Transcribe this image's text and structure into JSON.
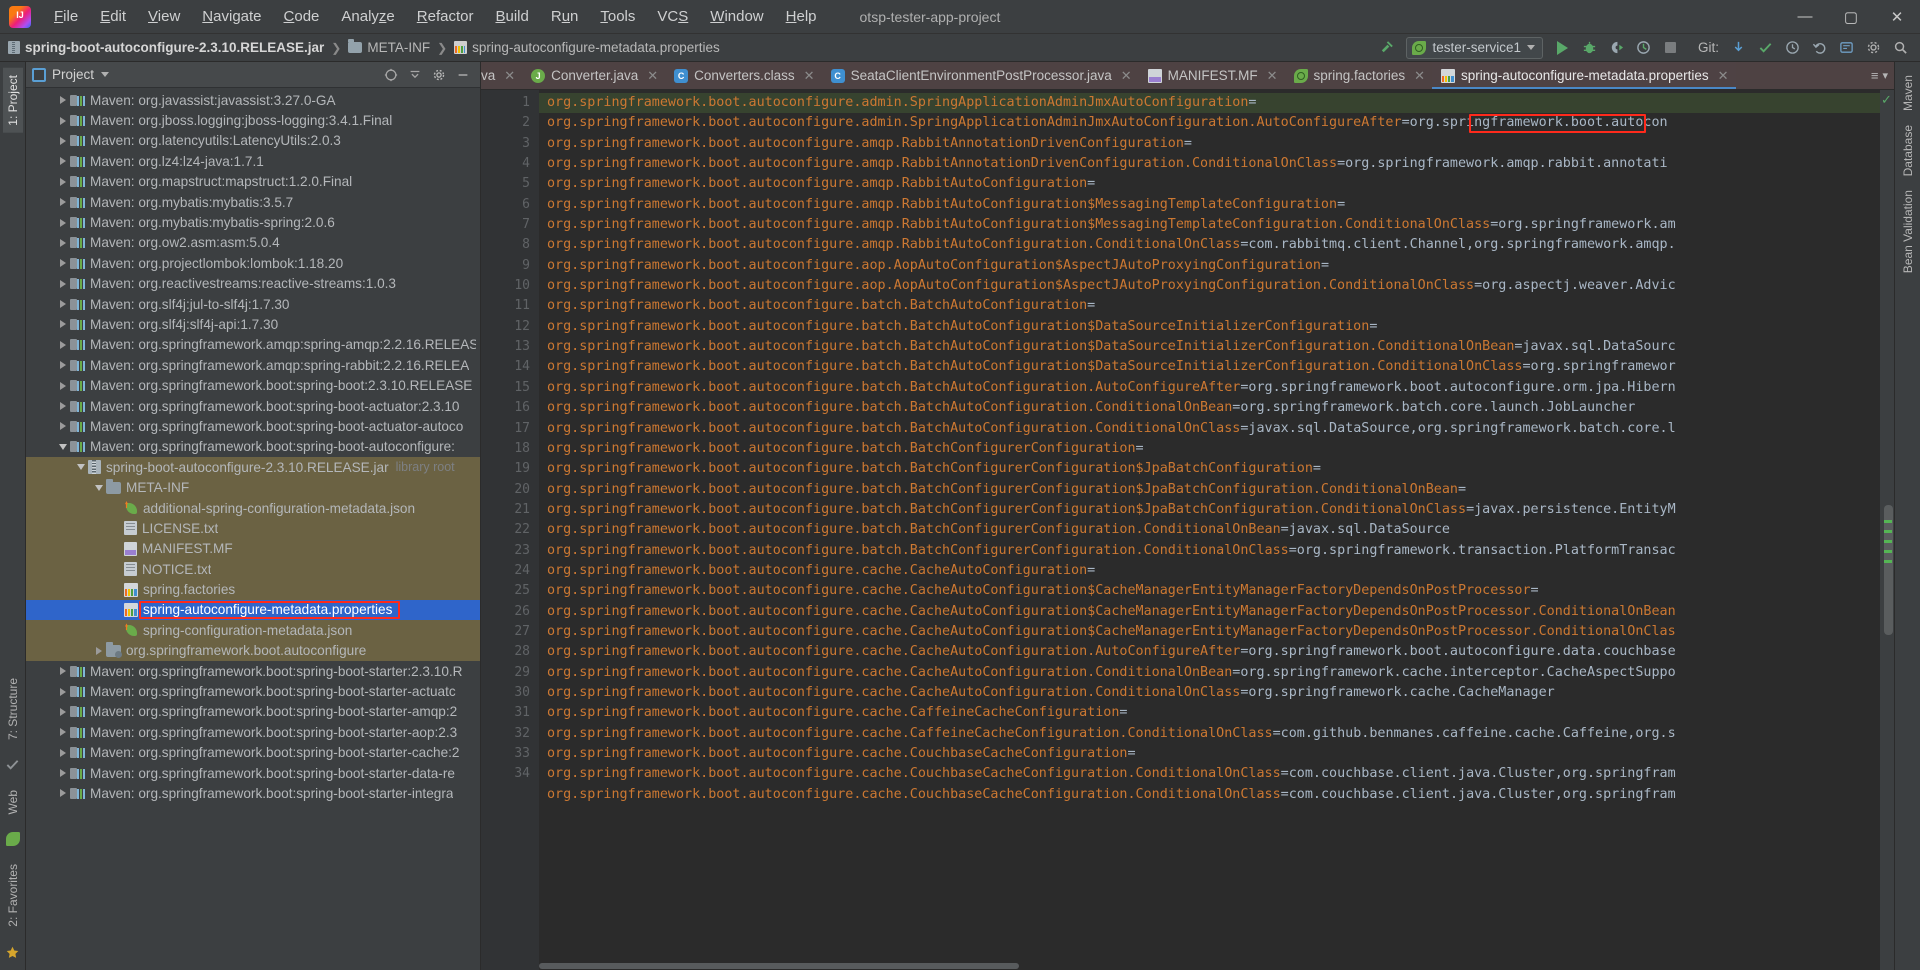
{
  "window": {
    "project_name": "otsp-tester-app-project",
    "logo_text": "IJ",
    "minimize": "—",
    "maximize": "▢",
    "close": "✕"
  },
  "menu": [
    {
      "label": "File"
    },
    {
      "label": "Edit"
    },
    {
      "label": "View"
    },
    {
      "label": "Navigate"
    },
    {
      "label": "Code"
    },
    {
      "label": "Analyze"
    },
    {
      "label": "Refactor"
    },
    {
      "label": "Build"
    },
    {
      "label": "Run"
    },
    {
      "label": "Tools"
    },
    {
      "label": "VCS"
    },
    {
      "label": "Window"
    },
    {
      "label": "Help"
    }
  ],
  "breadcrumb": {
    "items": [
      {
        "label": "spring-boot-autoconfigure-2.3.10.RELEASE.jar",
        "icon": "jar-icon"
      },
      {
        "label": "META-INF",
        "icon": "folder-icon"
      },
      {
        "label": "spring-autoconfigure-metadata.properties",
        "icon": "properties-icon"
      }
    ],
    "separator": "❯"
  },
  "toolbar": {
    "run_configuration": "tester-service1",
    "git_label": "Git:",
    "buttons": [
      "run",
      "debug",
      "run-with-coverage",
      "profiler",
      "stop"
    ],
    "git_buttons": [
      "update-project",
      "commit",
      "history",
      "rollback"
    ]
  },
  "project_panel": {
    "title": "Project",
    "tools": [
      "collapse-all",
      "expand-all",
      "settings",
      "hide"
    ]
  },
  "tree": [
    {
      "label": "Maven: org.javassist:javassist:3.27.0-GA",
      "icon": "maven-icon",
      "arrow": "right",
      "indent": 1
    },
    {
      "label": "Maven: org.jboss.logging:jboss-logging:3.4.1.Final",
      "icon": "maven-icon",
      "arrow": "right",
      "indent": 1
    },
    {
      "label": "Maven: org.latencyutils:LatencyUtils:2.0.3",
      "icon": "maven-icon",
      "arrow": "right",
      "indent": 1
    },
    {
      "label": "Maven: org.lz4:lz4-java:1.7.1",
      "icon": "maven-icon",
      "arrow": "right",
      "indent": 1
    },
    {
      "label": "Maven: org.mapstruct:mapstruct:1.2.0.Final",
      "icon": "maven-icon",
      "arrow": "right",
      "indent": 1
    },
    {
      "label": "Maven: org.mybatis:mybatis:3.5.7",
      "icon": "maven-icon",
      "arrow": "right",
      "indent": 1
    },
    {
      "label": "Maven: org.mybatis:mybatis-spring:2.0.6",
      "icon": "maven-icon",
      "arrow": "right",
      "indent": 1
    },
    {
      "label": "Maven: org.ow2.asm:asm:5.0.4",
      "icon": "maven-icon",
      "arrow": "right",
      "indent": 1
    },
    {
      "label": "Maven: org.projectlombok:lombok:1.18.20",
      "icon": "maven-icon",
      "arrow": "right",
      "indent": 1
    },
    {
      "label": "Maven: org.reactivestreams:reactive-streams:1.0.3",
      "icon": "maven-icon",
      "arrow": "right",
      "indent": 1
    },
    {
      "label": "Maven: org.slf4j:jul-to-slf4j:1.7.30",
      "icon": "maven-icon",
      "arrow": "right",
      "indent": 1
    },
    {
      "label": "Maven: org.slf4j:slf4j-api:1.7.30",
      "icon": "maven-icon",
      "arrow": "right",
      "indent": 1
    },
    {
      "label": "Maven: org.springframework.amqp:spring-amqp:2.2.16.RELEAS",
      "icon": "maven-icon",
      "arrow": "right",
      "indent": 1
    },
    {
      "label": "Maven: org.springframework.amqp:spring-rabbit:2.2.16.RELEA",
      "icon": "maven-icon",
      "arrow": "right",
      "indent": 1
    },
    {
      "label": "Maven: org.springframework.boot:spring-boot:2.3.10.RELEASE",
      "icon": "maven-icon",
      "arrow": "right",
      "indent": 1
    },
    {
      "label": "Maven: org.springframework.boot:spring-boot-actuator:2.3.10",
      "icon": "maven-icon",
      "arrow": "right",
      "indent": 1
    },
    {
      "label": "Maven: org.springframework.boot:spring-boot-actuator-autoco",
      "icon": "maven-icon",
      "arrow": "right",
      "indent": 1
    },
    {
      "label": "Maven: org.springframework.boot:spring-boot-autoconfigure:",
      "icon": "maven-icon",
      "arrow": "down",
      "indent": 1
    },
    {
      "label": "spring-boot-autoconfigure-2.3.10.RELEASE.jar",
      "sub": "library root",
      "icon": "jar-icon",
      "arrow": "down",
      "indent": 2,
      "highlight": "jar"
    },
    {
      "label": "META-INF",
      "icon": "folder-icon",
      "arrow": "down",
      "indent": 3,
      "highlight": "jar"
    },
    {
      "label": "additional-spring-configuration-metadata.json",
      "icon": "json-icon",
      "arrow": "none",
      "indent": 4,
      "highlight": "jar"
    },
    {
      "label": "LICENSE.txt",
      "icon": "text-icon",
      "arrow": "none",
      "indent": 4,
      "highlight": "jar"
    },
    {
      "label": "MANIFEST.MF",
      "icon": "manifest-icon",
      "arrow": "none",
      "indent": 4,
      "highlight": "jar"
    },
    {
      "label": "NOTICE.txt",
      "icon": "text-icon",
      "arrow": "none",
      "indent": 4,
      "highlight": "jar"
    },
    {
      "label": "spring.factories",
      "icon": "leaf-icon",
      "arrow": "none",
      "indent": 4,
      "highlight": "jar"
    },
    {
      "label": "spring-autoconfigure-metadata.properties",
      "icon": "properties-icon",
      "arrow": "none",
      "indent": 4,
      "highlight": "selected",
      "annotated": true
    },
    {
      "label": "spring-configuration-metadata.json",
      "icon": "json-icon",
      "arrow": "none",
      "indent": 4,
      "highlight": "jar"
    },
    {
      "label": "org.springframework.boot.autoconfigure",
      "icon": "package-icon",
      "arrow": "right",
      "indent": 3,
      "highlight": "jar"
    },
    {
      "label": "Maven: org.springframework.boot:spring-boot-starter:2.3.10.R",
      "icon": "maven-icon",
      "arrow": "right",
      "indent": 1
    },
    {
      "label": "Maven: org.springframework.boot:spring-boot-starter-actuatc",
      "icon": "maven-icon",
      "arrow": "right",
      "indent": 1
    },
    {
      "label": "Maven: org.springframework.boot:spring-boot-starter-amqp:2",
      "icon": "maven-icon",
      "arrow": "right",
      "indent": 1
    },
    {
      "label": "Maven: org.springframework.boot:spring-boot-starter-aop:2.3",
      "icon": "maven-icon",
      "arrow": "right",
      "indent": 1
    },
    {
      "label": "Maven: org.springframework.boot:spring-boot-starter-cache:2",
      "icon": "maven-icon",
      "arrow": "right",
      "indent": 1
    },
    {
      "label": "Maven: org.springframework.boot:spring-boot-starter-data-re",
      "icon": "maven-icon",
      "arrow": "right",
      "indent": 1
    },
    {
      "label": "Maven: org.springframework.boot:spring-boot-starter-integra",
      "icon": "maven-icon",
      "arrow": "right",
      "indent": 1
    }
  ],
  "editor_tabs": [
    {
      "label": "va",
      "icon": "java-icon",
      "active": false,
      "partial": true
    },
    {
      "label": "Converter.java",
      "icon": "java-icon",
      "active": false
    },
    {
      "label": "Converters.class",
      "icon": "class-icon",
      "active": false
    },
    {
      "label": "SeataClientEnvironmentPostProcessor.java",
      "icon": "class-icon",
      "active": false
    },
    {
      "label": "MANIFEST.MF",
      "icon": "manifest-icon",
      "active": false
    },
    {
      "label": "spring.factories",
      "icon": "leaf-icon",
      "active": false
    },
    {
      "label": "spring-autoconfigure-metadata.properties",
      "icon": "properties-icon",
      "active": true
    }
  ],
  "editor": {
    "line_numbers": [
      1,
      2,
      3,
      4,
      5,
      6,
      7,
      8,
      9,
      10,
      11,
      12,
      13,
      14,
      15,
      16,
      17,
      18,
      19,
      20,
      21,
      22,
      23,
      24,
      25,
      26,
      27,
      28,
      29,
      30,
      31,
      32,
      33,
      34
    ],
    "lines": [
      "org.springframework.boot.autoconfigure.admin.SpringApplicationAdminJmxAutoConfiguration=",
      "org.springframework.boot.autoconfigure.admin.SpringApplicationAdminJmxAutoConfiguration.AutoConfigureAfter=org.springframework.boot.autocon",
      "org.springframework.boot.autoconfigure.amqp.RabbitAnnotationDrivenConfiguration=",
      "org.springframework.boot.autoconfigure.amqp.RabbitAnnotationDrivenConfiguration.ConditionalOnClass=org.springframework.amqp.rabbit.annotati",
      "org.springframework.boot.autoconfigure.amqp.RabbitAutoConfiguration=",
      "org.springframework.boot.autoconfigure.amqp.RabbitAutoConfiguration$MessagingTemplateConfiguration=",
      "org.springframework.boot.autoconfigure.amqp.RabbitAutoConfiguration$MessagingTemplateConfiguration.ConditionalOnClass=org.springframework.am",
      "org.springframework.boot.autoconfigure.amqp.RabbitAutoConfiguration.ConditionalOnClass=com.rabbitmq.client.Channel,org.springframework.amqp.",
      "org.springframework.boot.autoconfigure.aop.AopAutoConfiguration$AspectJAutoProxyingConfiguration=",
      "org.springframework.boot.autoconfigure.aop.AopAutoConfiguration$AspectJAutoProxyingConfiguration.ConditionalOnClass=org.aspectj.weaver.Advic",
      "org.springframework.boot.autoconfigure.batch.BatchAutoConfiguration=",
      "org.springframework.boot.autoconfigure.batch.BatchAutoConfiguration$DataSourceInitializerConfiguration=",
      "org.springframework.boot.autoconfigure.batch.BatchAutoConfiguration$DataSourceInitializerConfiguration.ConditionalOnBean=javax.sql.DataSourc",
      "org.springframework.boot.autoconfigure.batch.BatchAutoConfiguration$DataSourceInitializerConfiguration.ConditionalOnClass=org.springframewor",
      "org.springframework.boot.autoconfigure.batch.BatchAutoConfiguration.AutoConfigureAfter=org.springframework.boot.autoconfigure.orm.jpa.Hibern",
      "org.springframework.boot.autoconfigure.batch.BatchAutoConfiguration.ConditionalOnBean=org.springframework.batch.core.launch.JobLauncher",
      "org.springframework.boot.autoconfigure.batch.BatchAutoConfiguration.ConditionalOnClass=javax.sql.DataSource,org.springframework.batch.core.l",
      "org.springframework.boot.autoconfigure.batch.BatchConfigurerConfiguration=",
      "org.springframework.boot.autoconfigure.batch.BatchConfigurerConfiguration$JpaBatchConfiguration=",
      "org.springframework.boot.autoconfigure.batch.BatchConfigurerConfiguration$JpaBatchConfiguration.ConditionalOnBean=",
      "org.springframework.boot.autoconfigure.batch.BatchConfigurerConfiguration$JpaBatchConfiguration.ConditionalOnClass=javax.persistence.EntityM",
      "org.springframework.boot.autoconfigure.batch.BatchConfigurerConfiguration.ConditionalOnBean=javax.sql.DataSource",
      "org.springframework.boot.autoconfigure.batch.BatchConfigurerConfiguration.ConditionalOnClass=org.springframework.transaction.PlatformTransac",
      "org.springframework.boot.autoconfigure.cache.CacheAutoConfiguration=",
      "org.springframework.boot.autoconfigure.cache.CacheAutoConfiguration$CacheManagerEntityManagerFactoryDependsOnPostProcessor=",
      "org.springframework.boot.autoconfigure.cache.CacheAutoConfiguration$CacheManagerEntityManagerFactoryDependsOnPostProcessor.ConditionalOnBean",
      "org.springframework.boot.autoconfigure.cache.CacheAutoConfiguration$CacheManagerEntityManagerFactoryDependsOnPostProcessor.ConditionalOnClas",
      "org.springframework.boot.autoconfigure.cache.CacheAutoConfiguration.AutoConfigureAfter=org.springframework.boot.autoconfigure.data.couchbase",
      "org.springframework.boot.autoconfigure.cache.CacheAutoConfiguration.ConditionalOnBean=org.springframework.cache.interceptor.CacheAspectSuppo",
      "org.springframework.boot.autoconfigure.cache.CacheAutoConfiguration.ConditionalOnClass=org.springframework.cache.CacheManager",
      "org.springframework.boot.autoconfigure.cache.CaffeineCacheConfiguration=",
      "org.springframework.boot.autoconfigure.cache.CaffeineCacheConfiguration.ConditionalOnClass=com.github.benmanes.caffeine.cache.Caffeine,org.s",
      "org.springframework.boot.autoconfigure.cache.CouchbaseCacheConfiguration=",
      "org.springframework.boot.autoconfigure.cache.CouchbaseCacheConfiguration.ConditionalOnClass=com.couchbase.client.java.Cluster,org.springfram",
      "org.springframework.boot.autoconfigure.cache.CouchbaseCacheConfiguration.ConditionalOnClass=com.couchbase.client.java.Cluster,org.springfram"
    ]
  },
  "left_rail": [
    {
      "label": "1: Project",
      "active": true,
      "type": "tab"
    },
    {
      "label": "7: Structure",
      "active": false,
      "type": "tab"
    },
    {
      "label": "Web",
      "active": false,
      "type": "tab"
    },
    {
      "label": "2: Favorites",
      "active": false,
      "type": "tab"
    }
  ],
  "right_rail": [
    {
      "label": "Maven",
      "active": false
    },
    {
      "label": "Database",
      "active": false
    },
    {
      "label": "Bean Validation",
      "active": false
    }
  ],
  "colors": {
    "accent_blue": "#2f65ca",
    "jar_highlight": "#6b6243",
    "annotation_red": "#ff2a1c",
    "code_orange": "#cc7832",
    "green": "#59a869",
    "tab_bar": "#4e4243"
  }
}
